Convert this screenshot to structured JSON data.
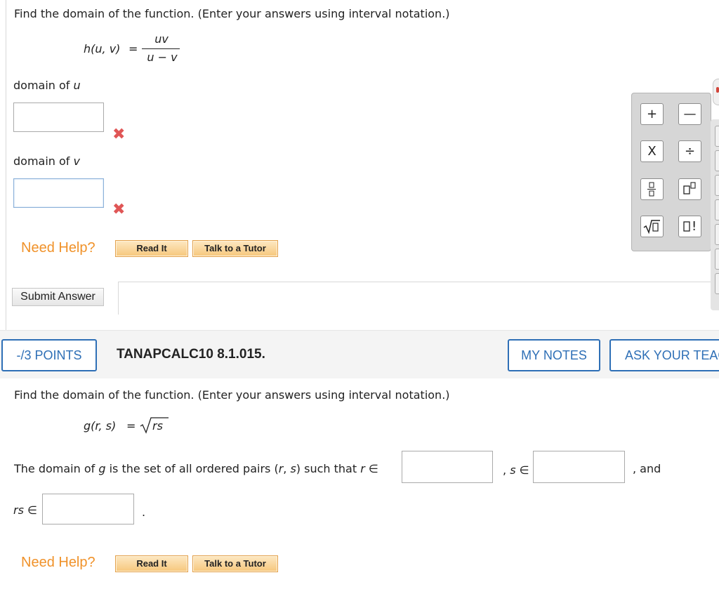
{
  "question1": {
    "prompt": "Find the domain of the function. (Enter your answers using interval notation.)",
    "function_lhs": "h(u, v)",
    "equals": "=",
    "numerator": "uv",
    "denominator": "u − v",
    "domain_u_label_prefix": "domain of ",
    "domain_u_var": "u",
    "domain_v_label_prefix": "domain of ",
    "domain_v_var": "v",
    "domain_u_value": "",
    "domain_v_value": "",
    "incorrect_mark": "✖",
    "need_help": "Need Help?",
    "read_it": "Read It",
    "talk_to_tutor": "Talk to a Tutor",
    "submit": "Submit Answer"
  },
  "math_palette": {
    "keys": [
      "+",
      "−",
      "X",
      "÷",
      "fraction",
      "exponent",
      "sqrt",
      "factorial"
    ],
    "key_glyphs": {
      "plus": "+",
      "minus": "—",
      "times": "X",
      "divide": "÷",
      "factorial": "!"
    }
  },
  "question2_header": {
    "points": "-/3 POINTS",
    "question_id": "TANAPCALC10 8.1.015.",
    "my_notes": "MY NOTES",
    "ask_teacher": "ASK YOUR TEACHER"
  },
  "question2": {
    "prompt": "Find the domain of the function. (Enter your answers using interval notation.)",
    "function_lhs": "g(r, s)",
    "equals": "=",
    "radicand": "rs",
    "domain_sentence_start": "The domain of ",
    "g_var": "g",
    "domain_sentence_mid": " is the set of all ordered pairs (",
    "pair_r": "r",
    "pair_comma": ", ",
    "pair_s": "s",
    "domain_sentence_end": ") such that ",
    "r_in": "r ∈",
    "comma_s_in_comma": ",",
    "s_in": "s ∈",
    "and_text": ", and",
    "rs_in": "rs ∈",
    "period": ".",
    "r_value": "",
    "s_value": "",
    "rs_value": "",
    "need_help": "Need Help?",
    "read_it": "Read It",
    "talk_to_tutor": "Talk to a Tutor"
  },
  "colors": {
    "accent_blue": "#2e6fb6",
    "help_orange": "#f0922a",
    "incorrect_red": "#e05656"
  }
}
